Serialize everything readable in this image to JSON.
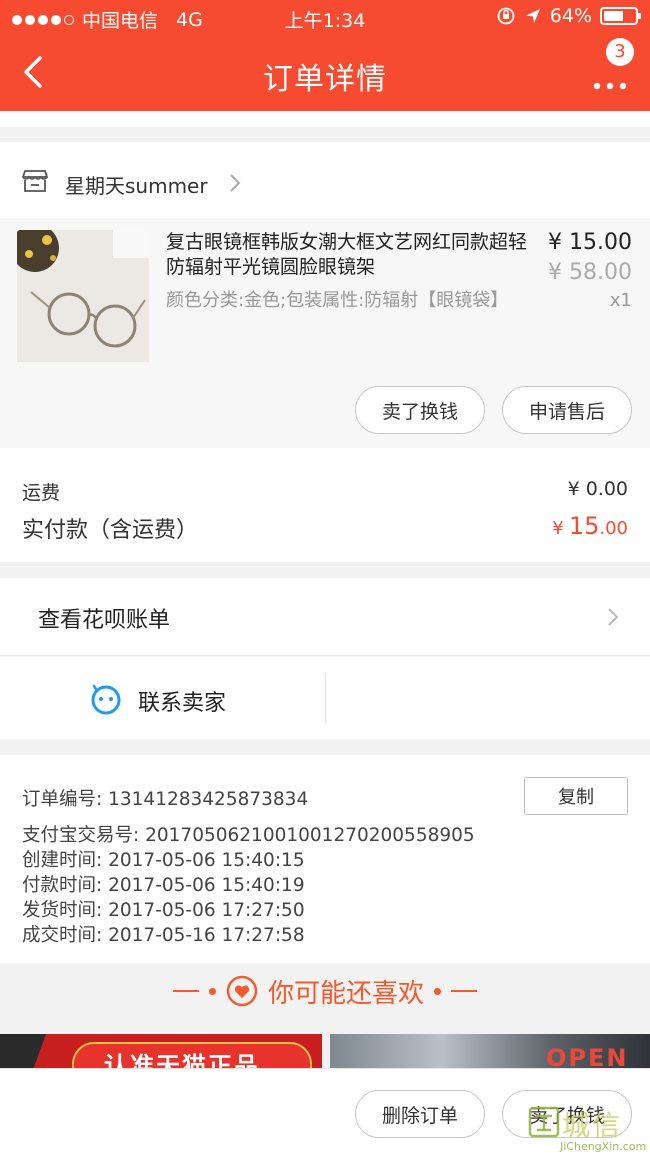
{
  "status_bar": {
    "carrier": "中国电信",
    "network": "4G",
    "time": "上午1:34",
    "battery": "64%",
    "battery_level": 0.64
  },
  "nav": {
    "title": "订单详情",
    "badge_count": "3"
  },
  "shop": {
    "name": "星期天summer"
  },
  "product": {
    "title": "复古眼镜框韩版女潮大框文艺网红同款超轻防辐射平光镜圆脸眼镜架",
    "spec": "颜色分类:金色;包装属性:防辐射【眼镜袋】",
    "price": "¥ 15.00",
    "original_price": "¥ 58.00",
    "quantity": "x1",
    "sell_button": "卖了换钱",
    "after_sale_button": "申请售后"
  },
  "fees": {
    "shipping_label": "运费",
    "shipping_value": "¥ 0.00",
    "total_label": "实付款（含运费）",
    "total_symbol": "¥",
    "total_int": "15",
    "total_dec": ".00"
  },
  "huabei": {
    "label": "查看花呗账单"
  },
  "contact": {
    "label": "联系卖家"
  },
  "order_info": {
    "copy_button": "复制",
    "lines": [
      "订单编号:  13141283425873834",
      "支付宝交易号:  2017050621001001270200558905",
      "创建时间:  2017-05-06 15:40:15",
      "付款时间:  2017-05-06 15:40:19",
      "发货时间:  2017-05-06 17:27:50",
      "成交时间:  2017-05-16 17:27:58"
    ]
  },
  "recommend": {
    "title": "你可能还喜欢",
    "ad_left": "认准天猫正品",
    "ad_right": "OPEN"
  },
  "bottom_bar": {
    "delete_button": "删除订单",
    "sell_button": "卖了换钱"
  },
  "watermark": {
    "big": "城信",
    "small": "JiChengXin.com"
  },
  "colors": {
    "brand": "#f74b31",
    "accent_text": "#f5592b",
    "background": "#f2f2f2"
  }
}
